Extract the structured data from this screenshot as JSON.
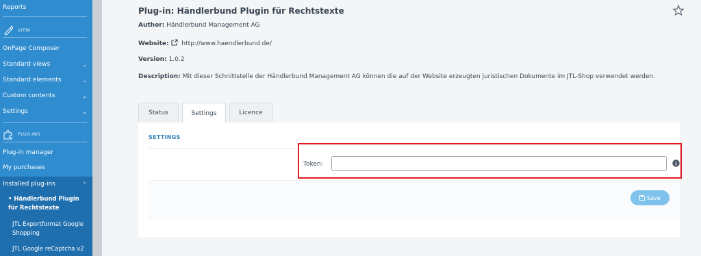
{
  "sidebar": {
    "items_top": [
      {
        "label": "Reports"
      }
    ],
    "section_view": "VIEW",
    "view_items": [
      {
        "label": "OnPage Composer"
      },
      {
        "label": "Standard views",
        "chevron": "chevron-down-icon"
      },
      {
        "label": "Standard elements",
        "chevron": "chevron-down-icon"
      },
      {
        "label": "Custom contents",
        "chevron": "chevron-down-icon"
      },
      {
        "label": "Settings",
        "chevron": "chevron-down-icon"
      }
    ],
    "section_plugins": "PLUG-INS",
    "plugin_items": [
      {
        "label": "Plug-in manager"
      },
      {
        "label": "My purchases"
      },
      {
        "label": "Installed plug-ins",
        "chevron": "chevron-up-icon"
      }
    ],
    "installed": [
      "• Händlerbund Plugin für Rechtstexte",
      "JTL Exportformat Google Shopping",
      "JTL Google reCaptcha v2"
    ],
    "chevron_down_glyph": "⌄",
    "chevron_up_glyph": "⌃"
  },
  "plugin": {
    "title": "Plug-in: Händlerbund Plugin für Rechtstexte",
    "author_label": "Author:",
    "author": "Händlerbund Management AG",
    "website_label": "Website:",
    "website": "http://www.haendlerbund.de/",
    "version_label": "Version:",
    "version": "1.0.2",
    "description_label": "Description:",
    "description": "Mit dieser Schnittstelle der Händlerbund Management AG können die auf der Website erzeugten juristischen Dokumente im JTL-Shop verwendet werden."
  },
  "tabs": [
    {
      "label": "Status"
    },
    {
      "label": "Settings"
    },
    {
      "label": "Licence"
    }
  ],
  "settings": {
    "section_title": "SETTINGS",
    "token_label": "Token:",
    "token_value": "",
    "save_label": "Save"
  },
  "colors": {
    "sidebar": "#2f8ccf",
    "sidebar_active": "#1f6ead",
    "highlight": "#e11b22",
    "save_button": "#7fc3ec"
  }
}
